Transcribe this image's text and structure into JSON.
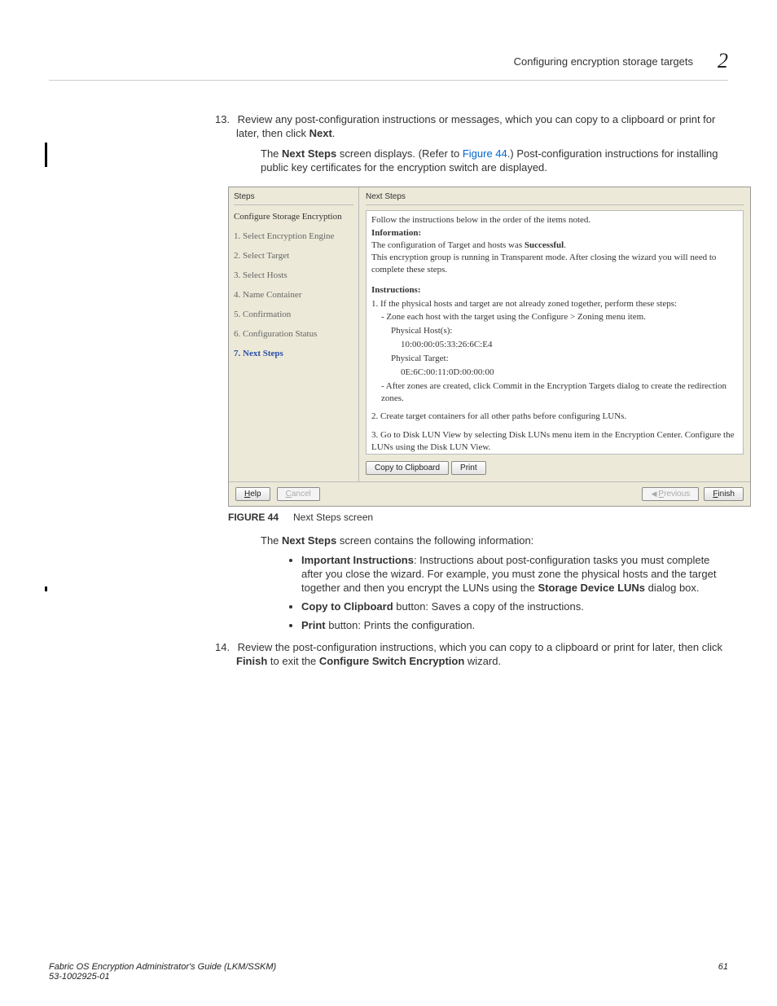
{
  "header": {
    "title": "Configuring encryption storage targets",
    "chapter": "2"
  },
  "step13": {
    "num": "13.",
    "text1": "Review any post-configuration instructions or messages, which you can copy to a clipboard or print for later, then click ",
    "next": "Next",
    "text2": ".",
    "desc1": "The ",
    "descBold": "Next Steps",
    "desc2": " screen displays. (Refer to ",
    "figref": "Figure 44",
    "desc3": ".) Post-configuration instructions for installing public key certificates for the encryption switch are displayed."
  },
  "screenshot": {
    "left": {
      "stepsLabel": "Steps",
      "group": "Configure Storage Encryption",
      "s1": "1. Select Encryption Engine",
      "s2": "2. Select Target",
      "s3": "3. Select Hosts",
      "s4": "4. Name Container",
      "s5": "5. Confirmation",
      "s6": "6. Configuration Status",
      "s7": "7. Next Steps"
    },
    "right": {
      "title": "Next Steps",
      "lead": "Follow the instructions below in the order of the items noted.",
      "infoHdr": "Information:",
      "info1a": "The configuration of Target and hosts was ",
      "info1b": "Successful",
      "info1c": ".",
      "info2": "This encryption group is running in Transparent mode. After closing the wizard you will need to complete these steps.",
      "instrHdr": "Instructions:",
      "i1": "1. If the physical hosts and target are not already zoned together, perform these steps:",
      "i1a": "- Zone each host with the target using the Configure > Zoning menu item.",
      "i1b": "Physical Host(s):",
      "i1c": "10:00:00:05:33:26:6C:E4",
      "i1d": "Physical Target:",
      "i1e": "0E:6C:00:11:0D:00:00:00",
      "i1f": "- After zones are created, click Commit in the Encryption Targets dialog to create the redirection zones.",
      "i2": "2. Create target containers for all other paths before configuring LUNs.",
      "i3": "3. Go to Disk LUN View by selecting Disk LUNs menu item in the Encryption Center. Configure the LUNs using the Disk LUN View.",
      "copy": "Copy to Clipboard",
      "print": "Print"
    },
    "bottom": {
      "help": "Help",
      "cancel": "Cancel",
      "previous": "Previous",
      "finish": "Finish"
    }
  },
  "caption": {
    "label": "FIGURE 44",
    "text": "Next Steps screen"
  },
  "intro2": {
    "pre": "The ",
    "bold": "Next Steps",
    "post": " screen contains the following information:"
  },
  "bullets": {
    "b1a": "Important Instructions",
    "b1b": ": Instructions about post-configuration tasks you must complete after you close the wizard. For example, you must zone the physical hosts and the target together and then you encrypt the LUNs using the ",
    "b1c": "Storage Device LUNs",
    "b1d": " dialog box.",
    "b2a": "Copy to Clipboard",
    "b2b": " button: Saves a copy of the instructions.",
    "b3a": "Print",
    "b3b": " button: Prints the configuration."
  },
  "step14": {
    "num": "14.",
    "text1": "Review the post-configuration instructions, which you can copy to a clipboard or print for later, then click ",
    "finish": "Finish",
    "text2": " to exit the ",
    "wizard": "Configure Switch Encryption",
    "text3": " wizard."
  },
  "footer": {
    "left1": "Fabric OS Encryption Administrator's Guide  (LKM/SSKM)",
    "left2": "53-1002925-01",
    "right": "61"
  }
}
